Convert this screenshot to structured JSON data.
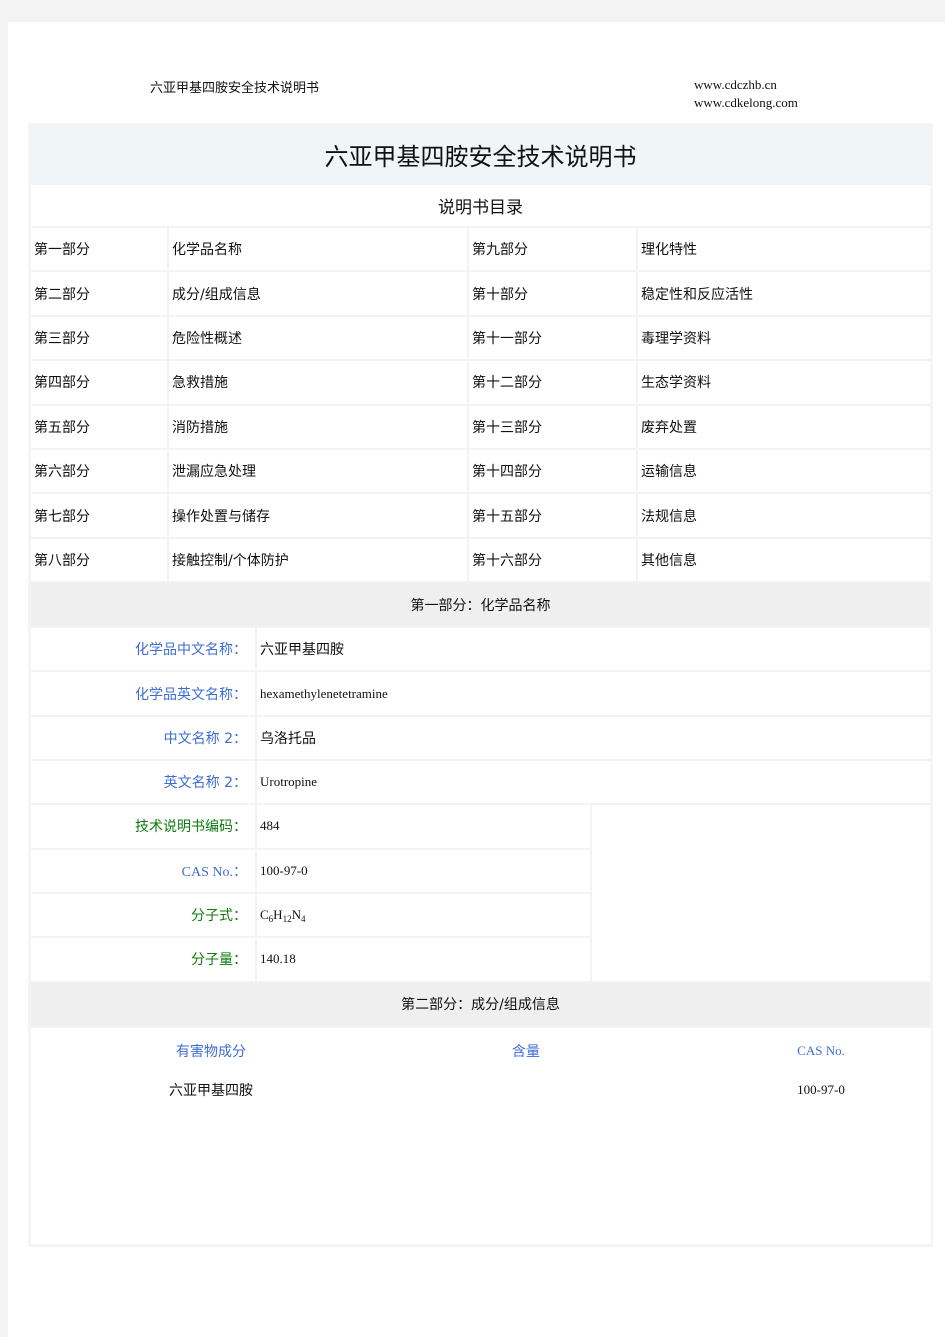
{
  "header": {
    "doc_title": "六亚甲基四胺安全技术说明书",
    "urls": [
      "www.cdczhb.cn",
      "www.cdkelong.com"
    ]
  },
  "document": {
    "title": "六亚甲基四胺安全技术说明书",
    "toc_title": "说明书目录",
    "toc": [
      {
        "part_left": "第一部分",
        "name_left": "化学品名称",
        "part_right": "第九部分",
        "name_right": "理化特性"
      },
      {
        "part_left": "第二部分",
        "name_left": "成分/组成信息",
        "part_right": "第十部分",
        "name_right": "稳定性和反应活性"
      },
      {
        "part_left": "第三部分",
        "name_left": "危险性概述",
        "part_right": "第十一部分",
        "name_right": "毒理学资料"
      },
      {
        "part_left": "第四部分",
        "name_left": "急救措施",
        "part_right": "第十二部分",
        "name_right": "生态学资料"
      },
      {
        "part_left": "第五部分",
        "name_left": "消防措施",
        "part_right": "第十三部分",
        "name_right": "废弃处置"
      },
      {
        "part_left": "第六部分",
        "name_left": "泄漏应急处理",
        "part_right": "第十四部分",
        "name_right": "运输信息"
      },
      {
        "part_left": "第七部分",
        "name_left": "操作处置与储存",
        "part_right": "第十五部分",
        "name_right": "法规信息"
      },
      {
        "part_left": "第八部分",
        "name_left": "接触控制/个体防护",
        "part_right": "第十六部分",
        "name_right": "其他信息"
      }
    ],
    "section1": {
      "heading": "第一部分：化学品名称",
      "fields": {
        "cn_name": {
          "label": "化学品中文名称：",
          "value": "六亚甲基四胺"
        },
        "en_name": {
          "label": "化学品英文名称：",
          "value": "hexamethylenetetramine"
        },
        "cn_name2": {
          "label": "中文名称 2：",
          "value": "乌洛托品"
        },
        "en_name2": {
          "label": "英文名称 2：",
          "value": "Urotropine"
        },
        "code": {
          "label": "技术说明书编码：",
          "value": "484"
        },
        "cas": {
          "label": "CAS No.：",
          "value": "100-97-0"
        },
        "formula": {
          "label": "分子式：",
          "value_parts": [
            "C",
            "6",
            "H",
            "12",
            "N",
            "4"
          ]
        },
        "mw": {
          "label": "分子量：",
          "value": "140.18"
        }
      }
    },
    "section2": {
      "heading": "第二部分：成分/组成信息",
      "columns": [
        "有害物成分",
        "含量",
        "CAS No."
      ],
      "rows": [
        {
          "component": "六亚甲基四胺",
          "content": "",
          "cas": "100-97-0"
        }
      ]
    }
  },
  "colors": {
    "label_blue": "#3e6dd1",
    "label_green": "#0f7a0f",
    "title_bg": "#f0f5f8",
    "section_bg": "#efefef"
  }
}
